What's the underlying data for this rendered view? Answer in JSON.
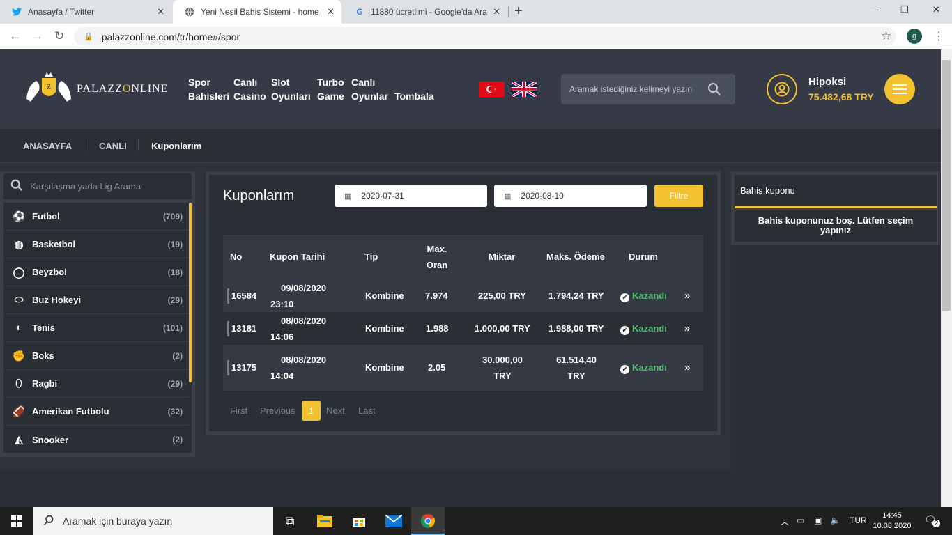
{
  "browser": {
    "tabs": [
      {
        "title": "Anasayfa / Twitter",
        "icon": "twitter-icon"
      },
      {
        "title": "Yeni Nesil Bahis Sistemi - home",
        "icon": "globe-icon"
      },
      {
        "title": "11880 ücretlimi - Google'da Ara",
        "icon": "google-icon"
      }
    ],
    "url": "palazzonline.com/tr/home#/spor",
    "profile_initial": "g"
  },
  "site": {
    "logo_text": "PALAZZ",
    "logo_text_o": "O",
    "logo_text_end": "NLINE",
    "nav": [
      {
        "line1": "Spor",
        "line2": "Bahisleri"
      },
      {
        "line1": "Canlı",
        "line2": "Casino"
      },
      {
        "line1": "Slot",
        "line2": "Oyunları"
      },
      {
        "line1": "Turbo",
        "line2": "Game"
      },
      {
        "line1": "Canlı",
        "line2": "Oyunlar"
      },
      {
        "line1": "",
        "line2": "Tombala"
      }
    ],
    "search_placeholder": "Aramak istediğiniz kelimeyi yazın",
    "user": {
      "name": "Hipoksi",
      "balance": "75.482,68 TRY"
    },
    "breadcrumb": [
      "ANASAYFA",
      "CANLI",
      "Kuponlarım"
    ],
    "accent_color": "#f2c230"
  },
  "sidebar": {
    "search_placeholder": "Karşılaşma yada Lig Arama",
    "sports": [
      {
        "name": "Futbol",
        "count": "(709)",
        "icon": "soccer-ball-icon"
      },
      {
        "name": "Basketbol",
        "count": "(19)",
        "icon": "basketball-icon"
      },
      {
        "name": "Beyzbol",
        "count": "(18)",
        "icon": "baseball-icon"
      },
      {
        "name": "Buz Hokeyi",
        "count": "(29)",
        "icon": "hockey-puck-icon"
      },
      {
        "name": "Tenis",
        "count": "(101)",
        "icon": "tennis-ball-icon"
      },
      {
        "name": "Boks",
        "count": "(2)",
        "icon": "boxing-glove-icon"
      },
      {
        "name": "Ragbi",
        "count": "(29)",
        "icon": "rugby-ball-icon"
      },
      {
        "name": "Amerikan Futbolu",
        "count": "(32)",
        "icon": "american-football-icon"
      },
      {
        "name": "Snooker",
        "count": "(2)",
        "icon": "snooker-icon"
      }
    ]
  },
  "coupons": {
    "title": "Kuponlarım",
    "date_from": "2020-07-31",
    "date_to": "2020-08-10",
    "filter_label": "Filtre",
    "headers": {
      "no": "No",
      "date": "Kupon Tarihi",
      "type": "Tip",
      "odds1": "Max.",
      "odds2": "Oran",
      "amount": "Miktar",
      "payout": "Maks. Ödeme",
      "status": "Durum"
    },
    "rows": [
      {
        "no": "16584",
        "date": "09/08/2020",
        "time": "23:10",
        "type": "Kombine",
        "odds": "7.974",
        "amount": "225,00 TRY",
        "payout": "1.794,24 TRY",
        "status": "Kazandı"
      },
      {
        "no": "13181",
        "date": "08/08/2020",
        "time": "14:06",
        "type": "Kombine",
        "odds": "1.988",
        "amount": "1.000,00 TRY",
        "payout": "1.988,00 TRY",
        "status": "Kazandı"
      },
      {
        "no": "13175",
        "date": "08/08/2020",
        "time": "14:04",
        "type": "Kombine",
        "odds": "2.05",
        "amount1": "30.000,00",
        "amount2": "TRY",
        "payout1": "61.514,40",
        "payout2": "TRY",
        "status": "Kazandı"
      }
    ],
    "pagination": {
      "first": "First",
      "previous": "Previous",
      "current": "1",
      "next": "Next",
      "last": "Last"
    }
  },
  "betslip": {
    "title": "Bahis kuponu",
    "empty_message": "Bahis kuponunuz boş. Lütfen seçim yapınız"
  },
  "taskbar": {
    "search_placeholder": "Aramak için buraya yazın",
    "language": "TUR",
    "time": "14:45",
    "date": "10.08.2020",
    "notification_count": "2"
  }
}
